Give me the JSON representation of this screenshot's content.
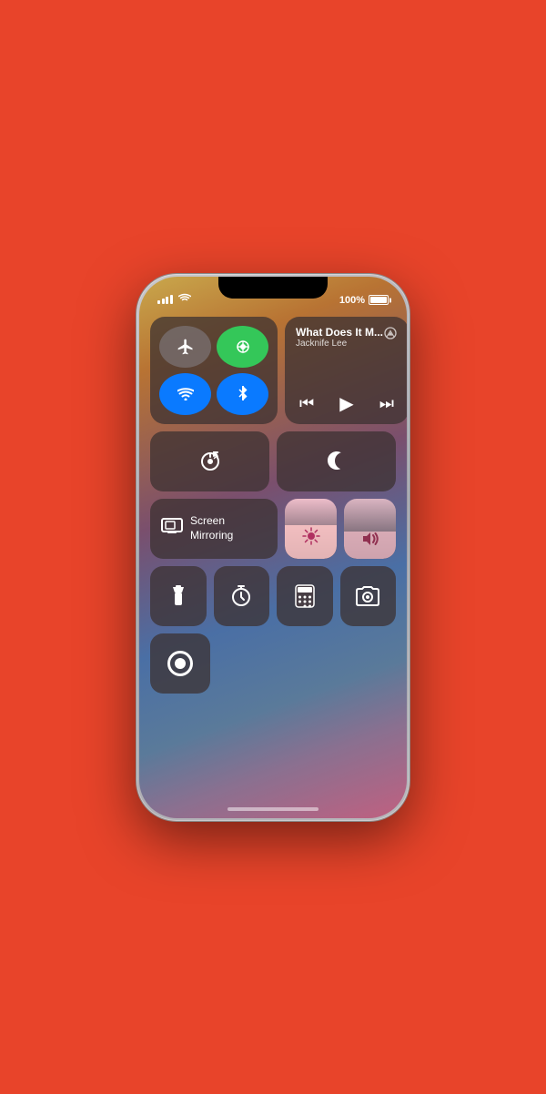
{
  "status": {
    "battery_percent": "100%",
    "signal_bars": 4,
    "wifi": true
  },
  "now_playing": {
    "title": "What Does It M...",
    "artist": "Jacknife Lee",
    "airplay_icon": "📡"
  },
  "controls": {
    "airplane_mode": false,
    "cellular": true,
    "wifi": true,
    "bluetooth": true,
    "rotation_lock_label": "Rotation Lock",
    "do_not_disturb_label": "Do Not Disturb",
    "screen_mirroring_label": "Screen\nMirroring",
    "brightness_value": 55,
    "volume_value": 45
  },
  "small_controls": {
    "flashlight": "Flashlight",
    "timer": "Timer",
    "calculator": "Calculator",
    "camera": "Camera"
  },
  "screen_record": {
    "label": "Screen Record"
  }
}
